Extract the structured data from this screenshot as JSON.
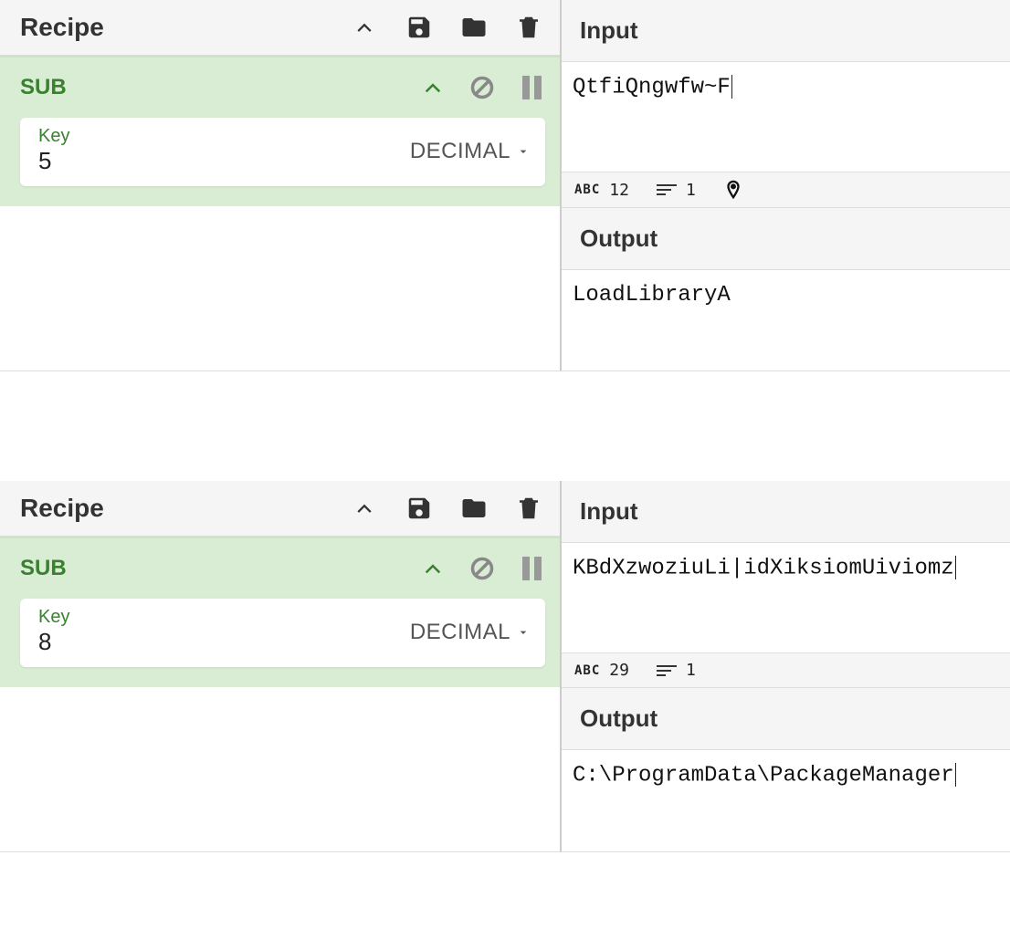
{
  "instances": [
    {
      "recipe": {
        "title": "Recipe",
        "op_name": "SUB",
        "arg_label": "Key",
        "arg_value": "5",
        "arg_type": "DECIMAL"
      },
      "input": {
        "title": "Input",
        "text": "QtfiQngwfw~F",
        "char_count": "12",
        "line_count": "1",
        "show_pin": true
      },
      "output": {
        "title": "Output",
        "text": "LoadLibraryA"
      }
    },
    {
      "recipe": {
        "title": "Recipe",
        "op_name": "SUB",
        "arg_label": "Key",
        "arg_value": "8",
        "arg_type": "DECIMAL"
      },
      "input": {
        "title": "Input",
        "text": "KBdXzwoziuLi|idXiksiomUiviomz",
        "char_count": "29",
        "line_count": "1",
        "show_pin": false
      },
      "output": {
        "title": "Output",
        "text": "C:\\ProgramData\\PackageManager"
      }
    }
  ]
}
